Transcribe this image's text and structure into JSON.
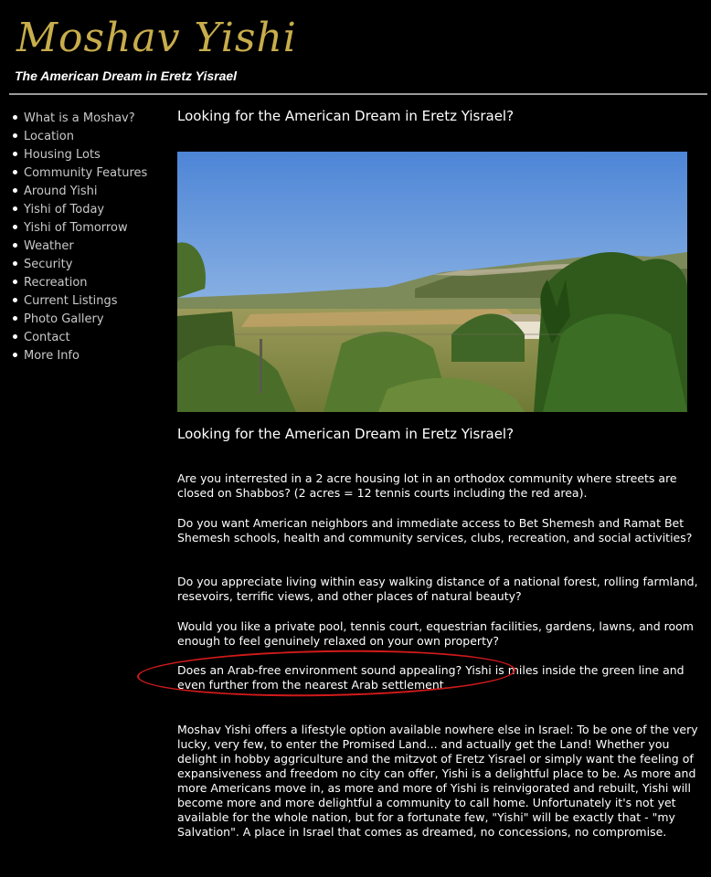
{
  "header": {
    "logo_text": "Moshav Yishi",
    "tagline": "The American Dream in Eretz Yisrael"
  },
  "sidebar": {
    "items": [
      {
        "label": "What is a Moshav?"
      },
      {
        "label": "Location"
      },
      {
        "label": "Housing Lots"
      },
      {
        "label": "Community Features"
      },
      {
        "label": "Around Yishi"
      },
      {
        "label": "Yishi of Today"
      },
      {
        "label": "Yishi of Tomorrow"
      },
      {
        "label": "Weather"
      },
      {
        "label": "Security"
      },
      {
        "label": "Recreation"
      },
      {
        "label": "Current Listings"
      },
      {
        "label": "Photo Gallery"
      },
      {
        "label": "Contact"
      },
      {
        "label": "More Info"
      }
    ]
  },
  "main": {
    "heading_top": "Looking for the American Dream in Eretz Yisrael?",
    "heading_second": "Looking for the American Dream in Eretz Yisrael?",
    "paragraphs": [
      "Are you interrested in a 2 acre housing lot in an orthodox community where streets are closed on Shabbos? (2 acres = 12 tennis courts including the red area).",
      "Do you want American neighbors and immediate access to Bet Shemesh and Ramat Bet Shemesh schools, health and community services, clubs, recreation, and social activities?",
      "Do you appreciate living within easy walking distance of a national forest, rolling farmland, resevoirs, terrific views, and other places of natural beauty?",
      "Would you like a private pool, tennis court, equestrian facilities, gardens, lawns, and room enough to feel genuinely relaxed on your own property?",
      "Does an Arab-free environment sound appealing? Yishi is miles inside the green line and even further from the nearest Arab settlement.",
      "Moshav Yishi offers a lifestyle option available nowhere else in Israel: To be one of the very lucky, very few, to enter the Promised Land... and actually get the Land! Whether you delight in hobby aggriculture and the mitzvot of Eretz Yisrael or simply want the feeling of expansiveness and freedom no city can offer, Yishi is a delightful place to be. As more and more Americans move in, as more and more of Yishi is reinvigorated and rebuilt, Yishi will become more and more delightful a community to call home. Unfortunately it's not yet available for the whole nation, but for a fortunate few, \"Yishi\" will be exactly that - \"my Salvation\". A place in Israel that comes as dreamed, no concessions, no compromise."
    ]
  },
  "colors": {
    "background": "#000000",
    "logo": "#c8ad4c",
    "nav_text": "#c9c9c9",
    "annotation_circle": "#d11a1a"
  }
}
